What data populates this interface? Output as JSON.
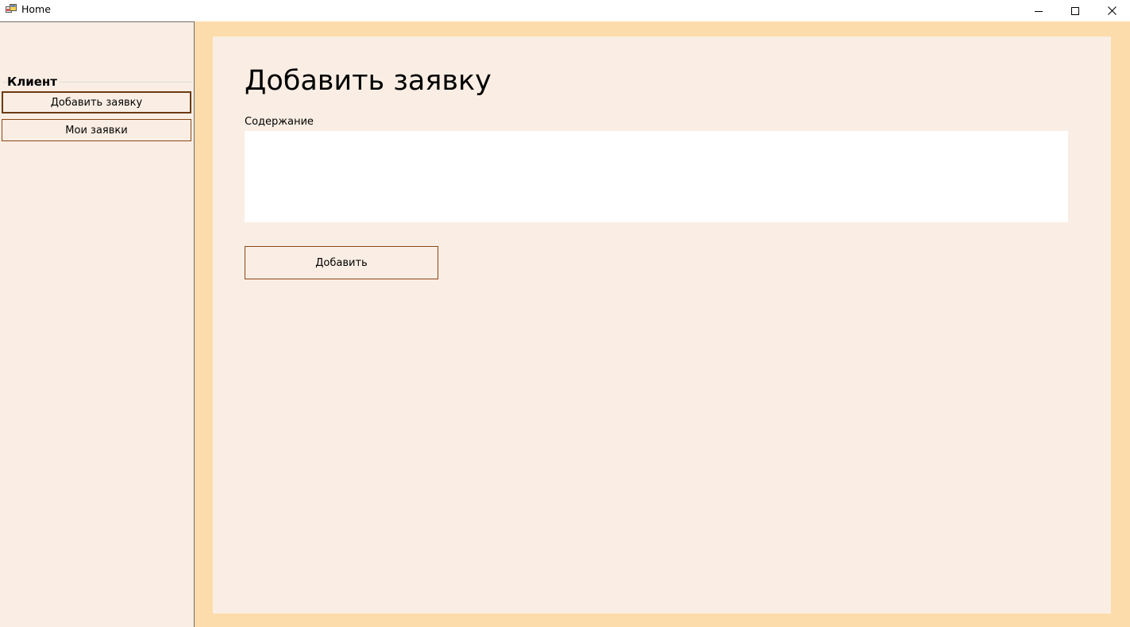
{
  "window": {
    "title": "Home",
    "controls": [
      "minimize-icon",
      "maximize-icon",
      "close-icon"
    ]
  },
  "sidebar": {
    "group_title": "Клиент",
    "items": [
      {
        "label": "Добавить заявку",
        "active": true
      },
      {
        "label": "Мои заявки",
        "active": false
      }
    ]
  },
  "main": {
    "title": "Добавить заявку",
    "content_label": "Содержание",
    "content_value": "",
    "submit_label": "Добавить"
  },
  "colors": {
    "sidebar_bg": "#faeee4",
    "frame_bg": "#fddcab",
    "button_border": "#8b4513"
  }
}
